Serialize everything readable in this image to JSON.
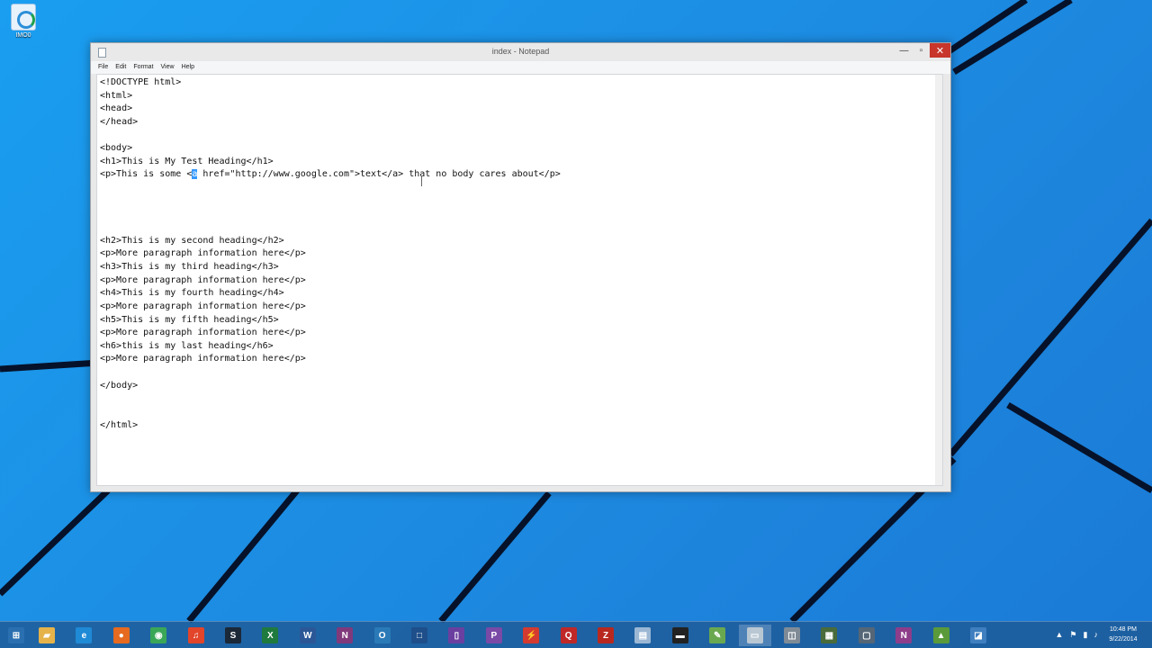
{
  "desktop": {
    "icon_label": "IMO0"
  },
  "window": {
    "title": "index - Notepad",
    "controls": {
      "minimize": "—",
      "maximize": "▫",
      "close": "✕"
    },
    "menu": [
      "File",
      "Edit",
      "Format",
      "View",
      "Help"
    ]
  },
  "editor": {
    "lines": [
      "<!DOCTYPE html>",
      "<html>",
      "<head>",
      "</head>",
      "",
      "<body>",
      "<h1>This is My Test Heading</h1>",
      "<p>This is some <a href=\"http://www.google.com\">text</a> that no body cares about</p>",
      "",
      "",
      "",
      "",
      "<h2>This is my second heading</h2>",
      "<p>More paragraph information here</p>",
      "<h3>This is my third heading</h3>",
      "<p>More paragraph information here</p>",
      "<h4>This is my fourth heading</h4>",
      "<p>More paragraph information here</p>",
      "<h5>This is my fifth heading</h5>",
      "<p>More paragraph information here</p>",
      "<h6>this is my last heading</h6>",
      "<p>More paragraph information here</p>",
      "",
      "</body>",
      "",
      "",
      "</html>"
    ],
    "selection": {
      "line": 7,
      "text": "a"
    }
  },
  "taskbar": {
    "apps": [
      {
        "name": "start-button",
        "glyph": "⊞",
        "color": "#2a6fb0"
      },
      {
        "name": "file-explorer",
        "glyph": "▰",
        "color": "#e6b34a"
      },
      {
        "name": "internet-explorer",
        "glyph": "e",
        "color": "#1f8ad6"
      },
      {
        "name": "firefox",
        "glyph": "●",
        "color": "#e66a1f"
      },
      {
        "name": "chrome",
        "glyph": "◉",
        "color": "#3aa757"
      },
      {
        "name": "media-app",
        "glyph": "♫",
        "color": "#e2452a"
      },
      {
        "name": "steam",
        "glyph": "S",
        "color": "#1b2838"
      },
      {
        "name": "excel",
        "glyph": "X",
        "color": "#1f7a3e"
      },
      {
        "name": "word",
        "glyph": "W",
        "color": "#2b5797"
      },
      {
        "name": "onenote",
        "glyph": "N",
        "color": "#80397b"
      },
      {
        "name": "outlook",
        "glyph": "O",
        "color": "#2a7ab8"
      },
      {
        "name": "app-blue",
        "glyph": "□",
        "color": "#1e4f8a"
      },
      {
        "name": "app-purple",
        "glyph": "▯",
        "color": "#6b3fa0"
      },
      {
        "name": "publisher",
        "glyph": "P",
        "color": "#7a4aa6"
      },
      {
        "name": "app-red",
        "glyph": "⚡",
        "color": "#d43a2f"
      },
      {
        "name": "app-q",
        "glyph": "Q",
        "color": "#c02828"
      },
      {
        "name": "filezilla",
        "glyph": "Z",
        "color": "#b8281e"
      },
      {
        "name": "document",
        "glyph": "▤",
        "color": "#9bb7d4"
      },
      {
        "name": "terminal",
        "glyph": "▬",
        "color": "#222222"
      },
      {
        "name": "notepad-plus",
        "glyph": "✎",
        "color": "#6aa84f"
      },
      {
        "name": "notepad",
        "glyph": "▭",
        "color": "#b9c7d3"
      },
      {
        "name": "app-gray",
        "glyph": "◫",
        "color": "#7f8b96"
      },
      {
        "name": "calendar",
        "glyph": "▦",
        "color": "#4a6b3a"
      },
      {
        "name": "app-window",
        "glyph": "▢",
        "color": "#556677"
      },
      {
        "name": "onenote-2",
        "glyph": "N",
        "color": "#8e3d8a"
      },
      {
        "name": "image-viewer",
        "glyph": "▲",
        "color": "#5a9a3a"
      },
      {
        "name": "remote-desktop",
        "glyph": "◪",
        "color": "#3f7fbf"
      }
    ],
    "active_index": 20,
    "tray_icons": [
      "▲",
      "⚑",
      "▮",
      "♪"
    ],
    "clock_time": "10:48 PM",
    "clock_date": "9/22/2014"
  }
}
